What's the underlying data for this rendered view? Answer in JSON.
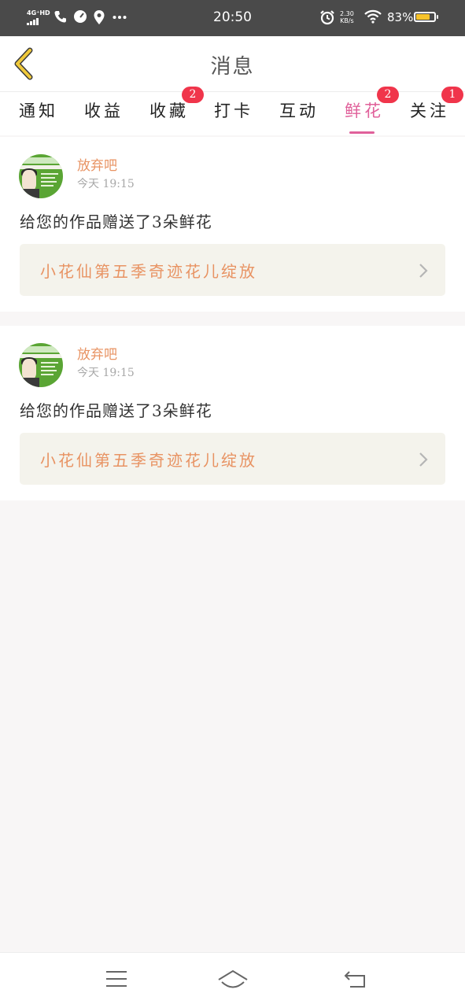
{
  "status_bar": {
    "network": "4G⁺HD",
    "time": "20:50",
    "speed_value": "2.30",
    "speed_unit": "KB/s",
    "battery": "83%",
    "battery_level": 0.83
  },
  "header": {
    "title": "消息"
  },
  "tabs": [
    {
      "label": "通知",
      "badge": "",
      "active": false
    },
    {
      "label": "收益",
      "badge": "",
      "active": false
    },
    {
      "label": "收藏",
      "badge": "2",
      "active": false
    },
    {
      "label": "打卡",
      "badge": "",
      "active": false
    },
    {
      "label": "互动",
      "badge": "",
      "active": false
    },
    {
      "label": "鲜花",
      "badge": "2",
      "active": true
    },
    {
      "label": "关注",
      "badge": "1",
      "active": false
    }
  ],
  "messages": [
    {
      "username": "放弃吧",
      "time": "今天 19:15",
      "text": "给您的作品赠送了3朵鲜花",
      "work_title": "小花仙第五季奇迹花儿绽放"
    },
    {
      "username": "放弃吧",
      "time": "今天 19:15",
      "text": "给您的作品赠送了3朵鲜花",
      "work_title": "小花仙第五季奇迹花儿绽放"
    }
  ],
  "colors": {
    "accent": "#e0609a",
    "username": "#e89363",
    "badge": "#f0354b",
    "back_arrow": "#f0c93a"
  }
}
